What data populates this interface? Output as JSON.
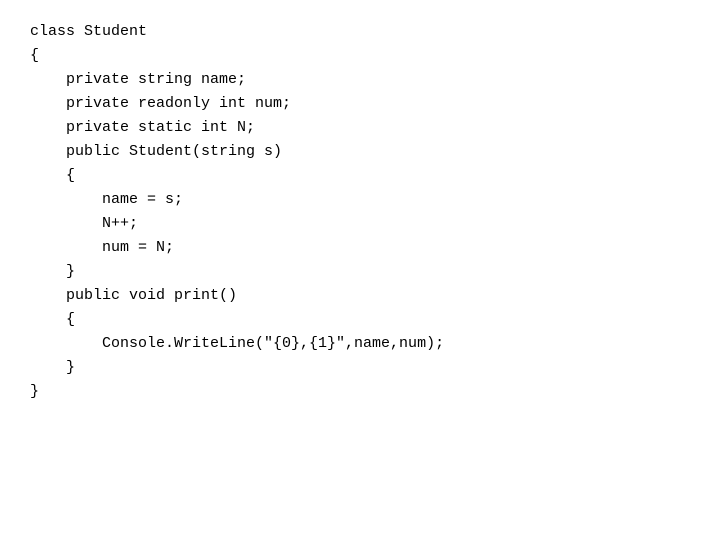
{
  "code": {
    "lines": [
      "class Student",
      "{",
      "    private string name;",
      "    private readonly int num;",
      "    private static int N;",
      "",
      "    public Student(string s)",
      "    {",
      "        name = s;",
      "        N++;",
      "        num = N;",
      "    }",
      "",
      "    public void print()",
      "    {",
      "        Console.WriteLine(\"{0},{1}\",name,num);",
      "    }",
      "}"
    ]
  }
}
